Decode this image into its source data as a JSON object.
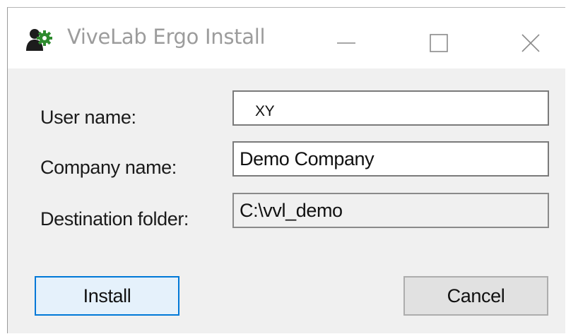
{
  "window": {
    "title": "ViveLab Ergo Install",
    "controls": {
      "minimize": "minimize-icon",
      "maximize": "maximize-icon",
      "close": "close-icon"
    },
    "app_icon": "vivelab-gear-person-icon"
  },
  "form": {
    "user_name": {
      "label": "User name:",
      "value": "XY"
    },
    "company_name": {
      "label": "Company name:",
      "value": "Demo Company"
    },
    "destination_folder": {
      "label": "Destination folder:",
      "value": "C:\\vvl_demo"
    }
  },
  "buttons": {
    "install": "Install",
    "cancel": "Cancel"
  },
  "colors": {
    "accent": "#0078d7",
    "app_icon_green": "#1f7a1f",
    "title_text": "#9c9c9c"
  }
}
